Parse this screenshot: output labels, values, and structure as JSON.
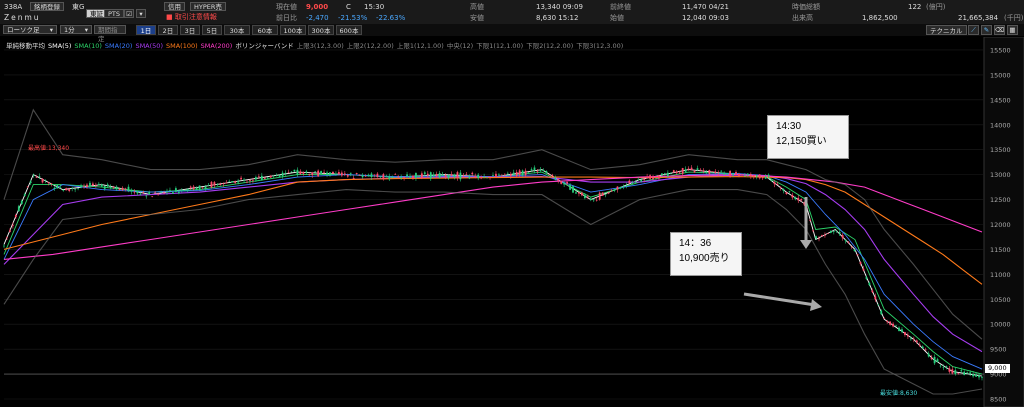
{
  "header": {
    "code": "338A",
    "tab_watch": "銘柄登録",
    "exchange": "東G",
    "name": "Zenmu",
    "btn_tse": "東証",
    "btn_pts": "PTS",
    "btn_credit": "信用",
    "btn_hyper": "HYPER売",
    "warning": "取引注意情報",
    "current_label": "現在値",
    "current_value": "9,000",
    "current_flag": "C",
    "current_time": "15:30",
    "change_label": "前日比",
    "change_value": "-2,470",
    "change_pct1": "-21.53%",
    "change_pct2": "-22.63%",
    "high_label": "高値",
    "high_value": "13,340 09:09",
    "low_label": "安値",
    "low_value": "8,630 15:12",
    "prev_close_label": "前終値",
    "prev_close_value": "11,470 04/21",
    "open_label": "始値",
    "open_value": "12,040 09:03",
    "shares_label": "時価総額",
    "shares_value": "122",
    "shares_unit": "(億円)",
    "volume_label": "出来高",
    "volume_value": "1,862,500",
    "turnover_value": "21,665,384",
    "turnover_unit": "(千円)"
  },
  "toolbar": {
    "chart_type": "ローソク足",
    "interval": "1分",
    "period_select": "期間指定",
    "timeframes": [
      "1日",
      "2日",
      "3日",
      "5日",
      "30本",
      "60本",
      "100本",
      "300本",
      "600本"
    ],
    "active_timeframe": 0,
    "technical": "テクニカル"
  },
  "legend": {
    "items": [
      {
        "text": "単純移動平均",
        "color": "#e0e0e0"
      },
      {
        "text": "SMA(5)",
        "color": "#ffffff"
      },
      {
        "text": "SMA(10)",
        "color": "#2cd46a"
      },
      {
        "text": "SMA(20)",
        "color": "#3a7bff"
      },
      {
        "text": "SMA(50)",
        "color": "#a63cf0"
      },
      {
        "text": "SMA(100)",
        "color": "#ff7a1a"
      },
      {
        "text": "SMA(200)",
        "color": "#ff3cc8"
      },
      {
        "text": "ボリンジャーバンド",
        "color": "#e0e0e0"
      },
      {
        "text": "上限3(12,3.00)",
        "color": "#888888"
      },
      {
        "text": "上限2(12,2.00)",
        "color": "#888888"
      },
      {
        "text": "上限1(12,1.00)",
        "color": "#888888"
      },
      {
        "text": "中央(12)",
        "color": "#888888"
      },
      {
        "text": "下限1(12,1.00)",
        "color": "#888888"
      },
      {
        "text": "下限2(12,2.00)",
        "color": "#888888"
      },
      {
        "text": "下限3(12,3.00)",
        "color": "#888888"
      }
    ]
  },
  "annotations": {
    "high_marker": "最高値:13,340",
    "low_marker": "最安値:8,630",
    "current_price_tag": "9,000",
    "callout1_time": "14:30",
    "callout1_text": "12,150買い",
    "callout2_time": "14：36",
    "callout2_text": "10,900売り"
  },
  "chart_data": {
    "type": "line",
    "ylim": [
      8500,
      15600
    ],
    "yticks": [
      "15500",
      "15000",
      "14500",
      "14000",
      "13500",
      "13000",
      "12500",
      "12000",
      "11500",
      "11000",
      "10500",
      "10000",
      "9500",
      "9000",
      "8500"
    ],
    "series": [
      {
        "name": "SMA(5)",
        "color": "#ffffff",
        "x": [
          0,
          3,
          6,
          10,
          15,
          20,
          25,
          30,
          35,
          40,
          45,
          50,
          55,
          60,
          65,
          70,
          75,
          78,
          80,
          82,
          83,
          85,
          87,
          90,
          93,
          95,
          97,
          100
        ],
        "values": [
          11600,
          13000,
          12700,
          12800,
          12600,
          12750,
          12900,
          13050,
          13000,
          12950,
          13000,
          12950,
          13100,
          12500,
          12900,
          13100,
          13000,
          12950,
          12650,
          12400,
          11700,
          11900,
          11500,
          10100,
          9700,
          9300,
          9050,
          8960
        ]
      },
      {
        "name": "SMA(10)",
        "color": "#2cd46a",
        "x": [
          0,
          3,
          6,
          10,
          15,
          20,
          25,
          30,
          35,
          40,
          45,
          50,
          55,
          60,
          65,
          70,
          75,
          78,
          80,
          82,
          83,
          85,
          87,
          90,
          93,
          95,
          97,
          100
        ],
        "values": [
          11400,
          12800,
          12800,
          12750,
          12650,
          12700,
          12850,
          13000,
          13000,
          12950,
          12980,
          12950,
          13050,
          12550,
          12850,
          13050,
          13020,
          12960,
          12750,
          12500,
          11900,
          11950,
          11700,
          10300,
          9800,
          9450,
          9150,
          9000
        ]
      },
      {
        "name": "SMA(20)",
        "color": "#3a7bff",
        "x": [
          0,
          3,
          6,
          10,
          15,
          20,
          25,
          30,
          35,
          40,
          45,
          50,
          55,
          60,
          65,
          70,
          75,
          78,
          80,
          82,
          84,
          86,
          88,
          90,
          93,
          95,
          97,
          100
        ],
        "values": [
          11300,
          12500,
          12800,
          12700,
          12650,
          12680,
          12800,
          12950,
          13000,
          12960,
          12970,
          12960,
          13000,
          12650,
          12800,
          13000,
          13020,
          12980,
          12850,
          12650,
          12200,
          11800,
          11300,
          10600,
          10000,
          9650,
          9350,
          9100
        ]
      },
      {
        "name": "SMA(50)",
        "color": "#a63cf0",
        "x": [
          0,
          3,
          6,
          10,
          15,
          20,
          25,
          30,
          35,
          40,
          45,
          50,
          55,
          60,
          65,
          70,
          75,
          78,
          80,
          82,
          84,
          86,
          88,
          90,
          93,
          95,
          97,
          100
        ],
        "values": [
          11200,
          11800,
          12400,
          12550,
          12600,
          12650,
          12750,
          12850,
          12900,
          12930,
          12950,
          12950,
          12960,
          12850,
          12850,
          12950,
          12990,
          12980,
          12920,
          12820,
          12600,
          12300,
          11900,
          11300,
          10600,
          10150,
          9800,
          9450
        ]
      },
      {
        "name": "SMA(100)",
        "color": "#ff7a1a",
        "x": [
          0,
          5,
          10,
          15,
          20,
          25,
          30,
          35,
          40,
          45,
          50,
          55,
          60,
          65,
          70,
          75,
          80,
          82,
          84,
          86,
          88,
          90,
          92,
          94,
          96,
          98,
          100
        ],
        "values": [
          11500,
          11750,
          12000,
          12200,
          12400,
          12600,
          12850,
          12900,
          12920,
          12930,
          12940,
          12950,
          12950,
          12940,
          12950,
          12960,
          12940,
          12900,
          12800,
          12650,
          12400,
          12150,
          11900,
          11650,
          11400,
          11100,
          10800
        ]
      },
      {
        "name": "SMA(200)",
        "color": "#ff3cc8",
        "x": [
          0,
          5,
          10,
          15,
          20,
          25,
          30,
          35,
          40,
          45,
          50,
          55,
          60,
          65,
          70,
          75,
          80,
          85,
          88,
          90,
          92,
          94,
          96,
          98,
          100
        ],
        "values": [
          11300,
          11400,
          11550,
          11700,
          11850,
          12000,
          12150,
          12300,
          12450,
          12600,
          12750,
          12850,
          12900,
          12950,
          12980,
          13000,
          12950,
          12850,
          12750,
          12600,
          12450,
          12300,
          12150,
          12000,
          11850
        ]
      },
      {
        "name": "上限3(12,3.00)",
        "color": "#6a6a6a",
        "x": [
          0,
          3,
          6,
          10,
          15,
          20,
          25,
          30,
          35,
          40,
          45,
          50,
          55,
          60,
          65,
          70,
          75,
          78,
          80,
          82,
          84,
          86,
          88,
          90,
          93,
          95,
          97,
          100
        ],
        "values": [
          12500,
          14300,
          13400,
          13300,
          13100,
          13100,
          13200,
          13400,
          13300,
          13250,
          13300,
          13300,
          13500,
          13100,
          13200,
          13400,
          13300,
          13300,
          13200,
          13100,
          12900,
          12800,
          12500,
          11900,
          11200,
          10700,
          10200,
          9700
        ]
      },
      {
        "name": "下限3(12,3.00)",
        "color": "#6a6a6a",
        "x": [
          0,
          3,
          6,
          10,
          15,
          20,
          25,
          30,
          35,
          40,
          45,
          50,
          55,
          60,
          65,
          70,
          75,
          78,
          80,
          82,
          84,
          86,
          88,
          90,
          93,
          95,
          97,
          100
        ],
        "values": [
          10400,
          11300,
          12100,
          12200,
          12200,
          12300,
          12500,
          12600,
          12700,
          12650,
          12650,
          12600,
          12600,
          12000,
          12500,
          12700,
          12700,
          12600,
          12300,
          11900,
          11200,
          10600,
          9800,
          9100,
          8800,
          8600,
          8600,
          8700
        ]
      }
    ]
  }
}
